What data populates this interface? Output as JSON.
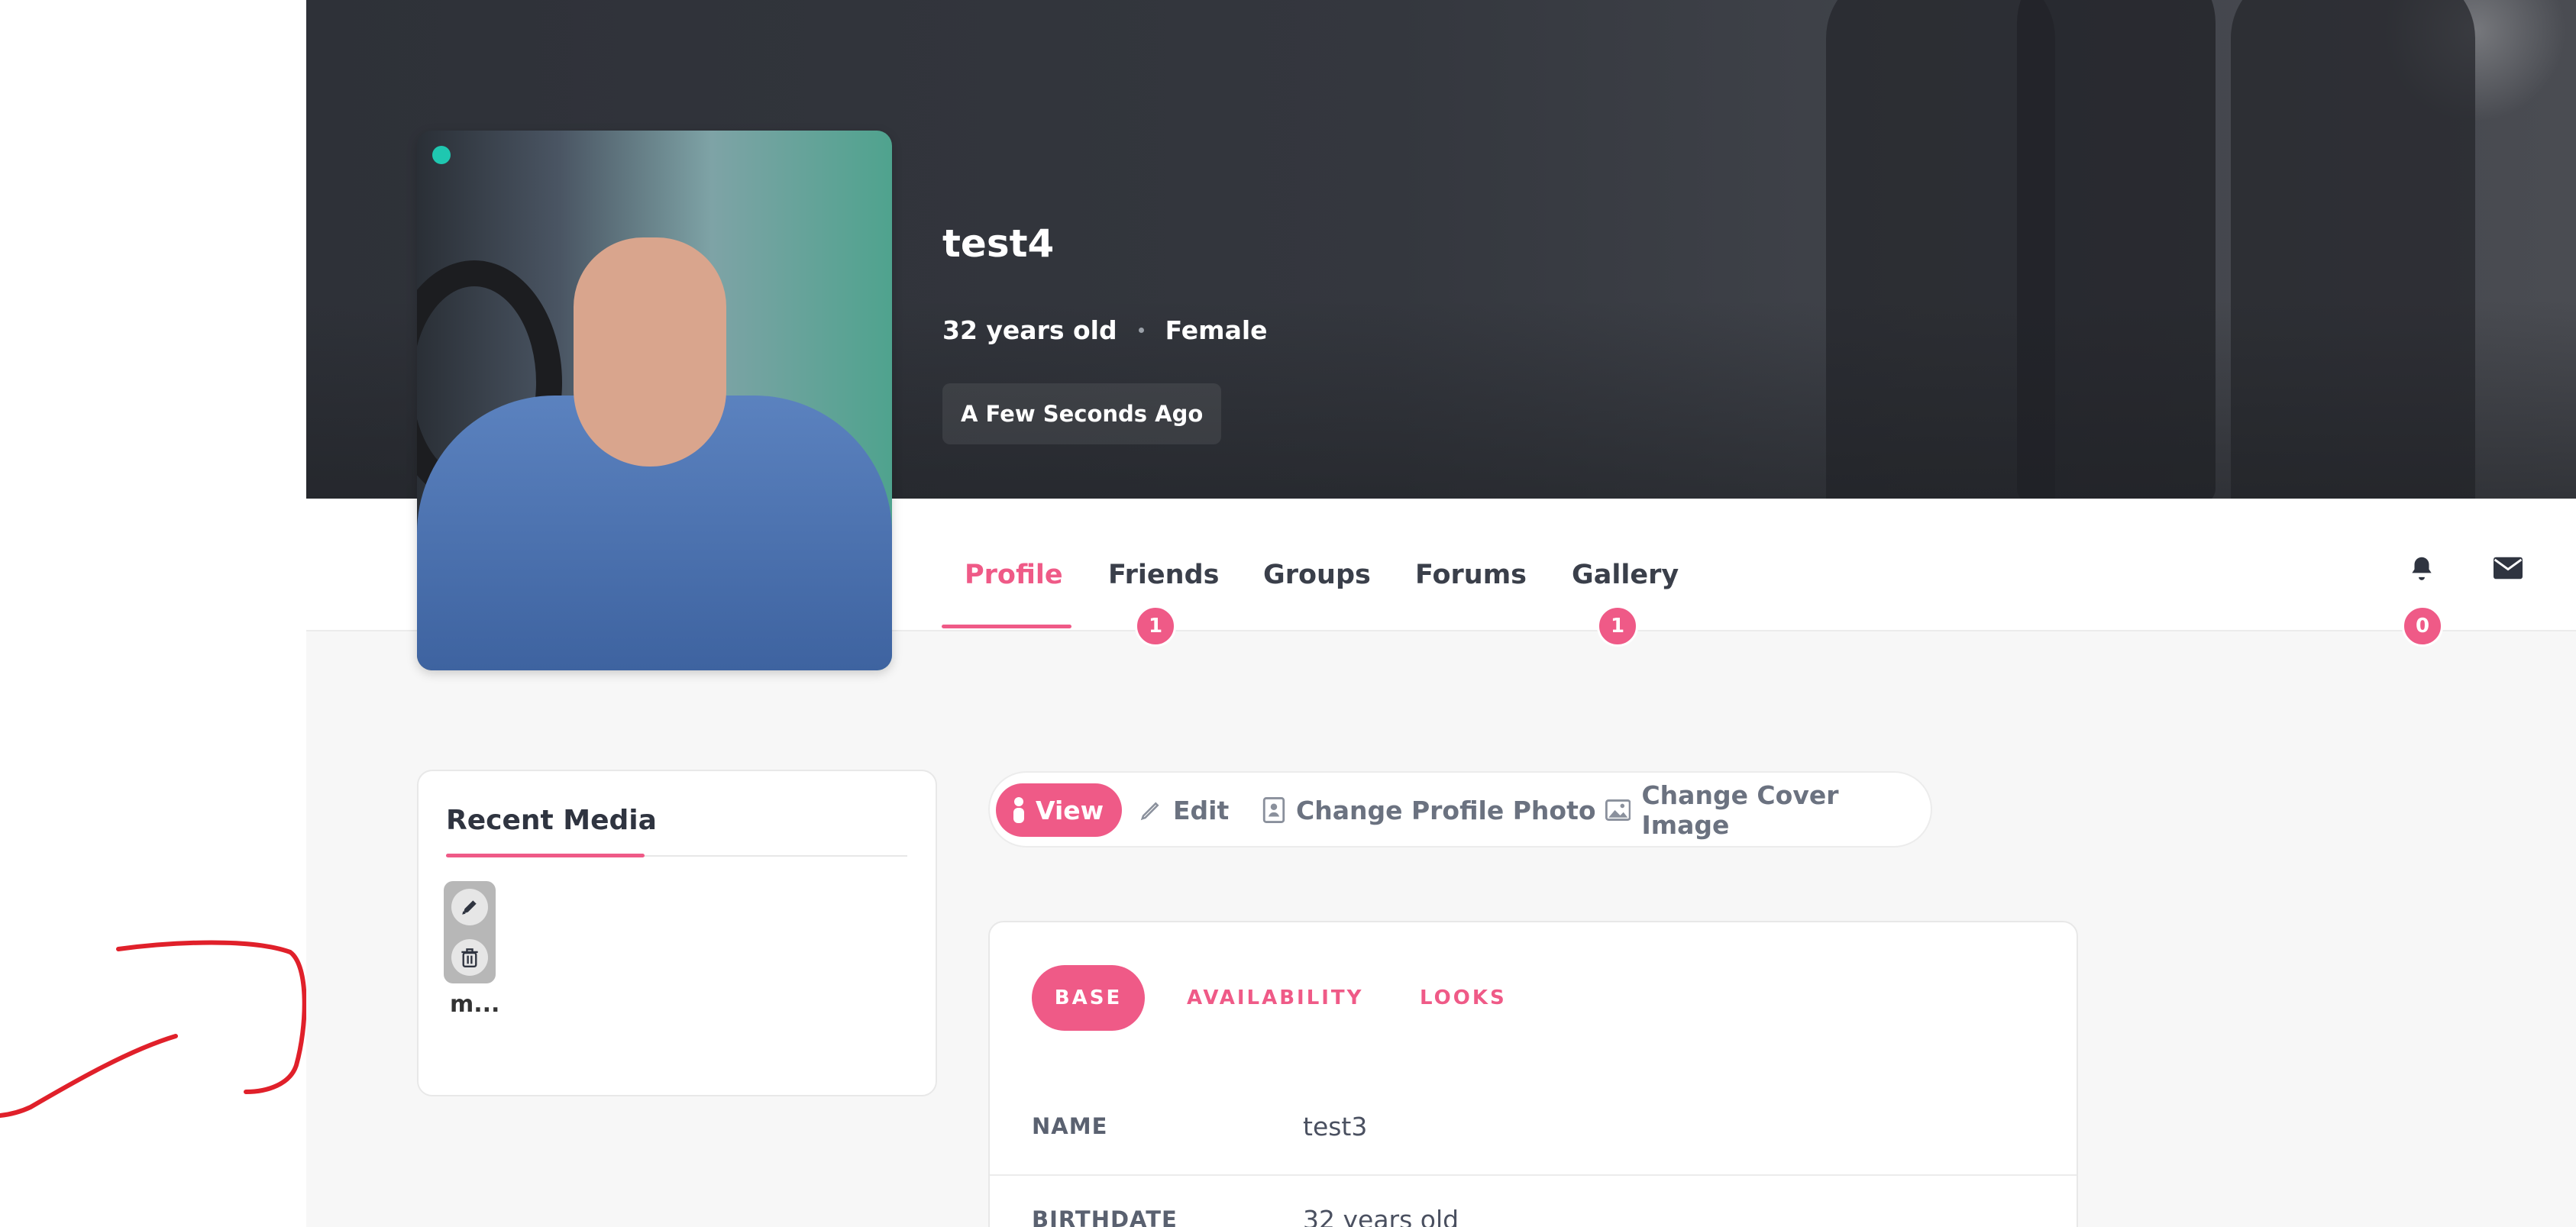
{
  "profile": {
    "name": "test4",
    "age": "32 years old",
    "gender": "Female",
    "last_seen": "A Few Seconds Ago",
    "online": true
  },
  "nav": {
    "tabs": [
      {
        "label": "Profile",
        "active": true
      },
      {
        "label": "Friends",
        "badge": "1"
      },
      {
        "label": "Groups"
      },
      {
        "label": "Forums"
      },
      {
        "label": "Gallery",
        "badge": "1"
      }
    ],
    "notifications": {
      "icon": "bell-icon",
      "count": "0"
    },
    "messages": {
      "icon": "envelope-icon"
    }
  },
  "recent_media": {
    "title": "Recent Media",
    "items": [
      {
        "caption": "m...",
        "actions": [
          "edit-icon",
          "trash-icon"
        ]
      }
    ]
  },
  "actions": [
    {
      "label": "View",
      "icon": "person-icon",
      "active": true
    },
    {
      "label": "Edit",
      "icon": "pencil-icon"
    },
    {
      "label": "Change Profile Photo",
      "icon": "portrait-icon"
    },
    {
      "label": "Change Cover Image",
      "icon": "image-icon"
    }
  ],
  "info_tabs": [
    {
      "label": "BASE",
      "active": true
    },
    {
      "label": "AVAILABILITY"
    },
    {
      "label": "LOOKS"
    }
  ],
  "info_rows": [
    {
      "label": "NAME",
      "value": "test3"
    },
    {
      "label": "BIRTHDATE",
      "value": "32 years old"
    }
  ],
  "colors": {
    "accent": "#ef5a87",
    "online": "#1fc7b0",
    "annotation": "#e0202a"
  }
}
